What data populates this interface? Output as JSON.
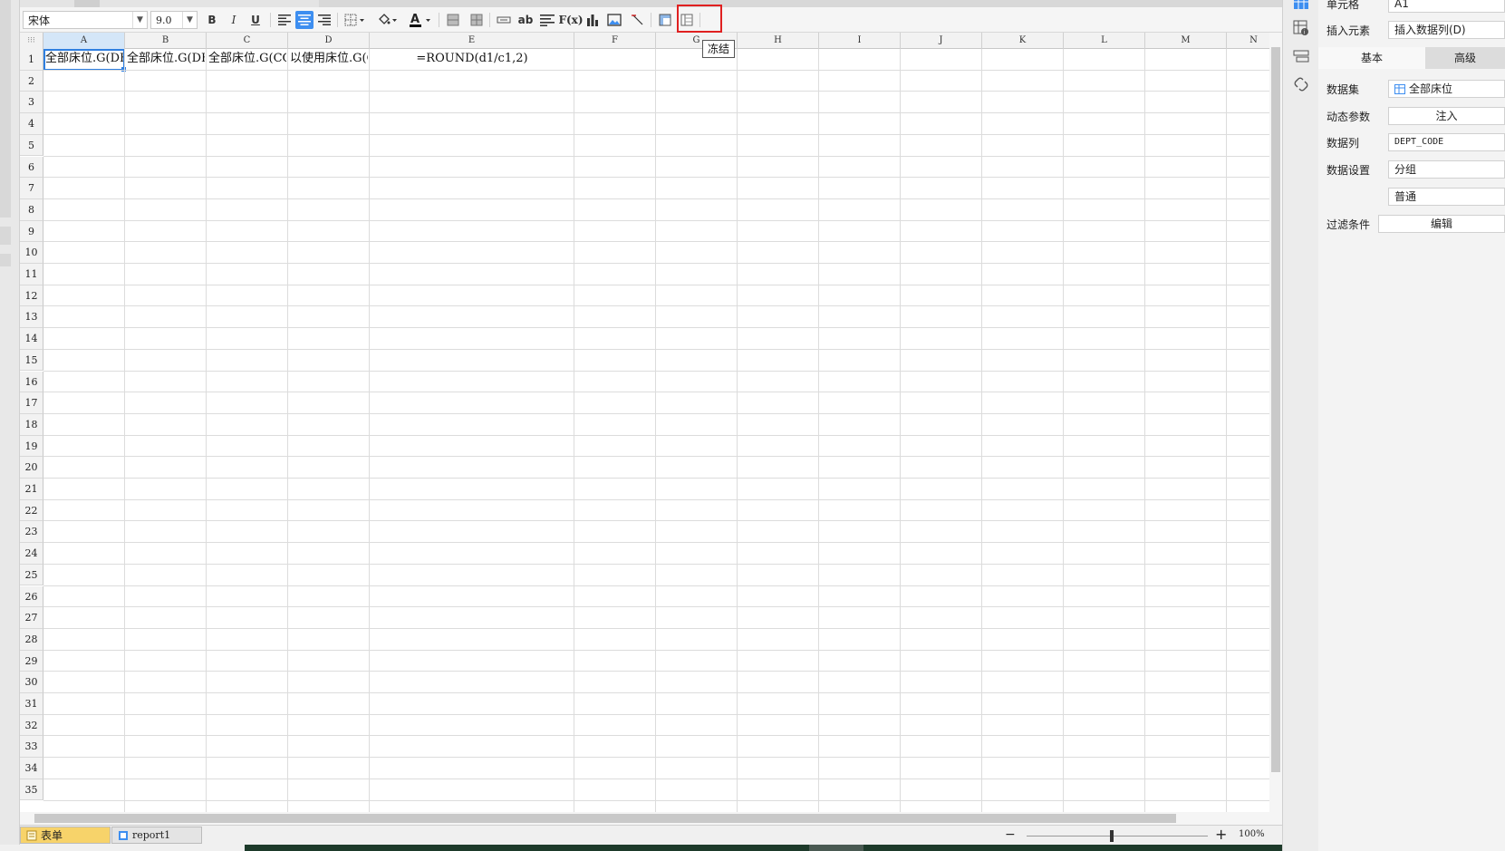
{
  "toolbar": {
    "font_name": "宋体",
    "font_size": "9.0",
    "bold": "B",
    "italic": "I",
    "underline": "U",
    "text_tool": "ab",
    "formula_tool": "F(x)",
    "tooltip": "冻结"
  },
  "columns": [
    "A",
    "B",
    "C",
    "D",
    "E",
    "F",
    "G",
    "H",
    "I",
    "J",
    "K",
    "L",
    "M",
    "N"
  ],
  "rows": [
    "1",
    "2",
    "3",
    "4",
    "5",
    "6",
    "7",
    "8",
    "9",
    "10",
    "11",
    "12",
    "13",
    "14",
    "15",
    "16",
    "17",
    "18",
    "19",
    "20",
    "21",
    "22",
    "23",
    "24",
    "25",
    "26",
    "27",
    "28",
    "29",
    "30",
    "31",
    "32",
    "33",
    "34",
    "35"
  ],
  "cells": {
    "a1": "全部床位.G(DEPT_CODE)",
    "b1": "全部床位.G(DEPT_NAME)",
    "c1": "全部床位.G(COUNT(*))",
    "d1": "以使用床位.G(COUNT(*))",
    "e1": "=ROUND(d1/c1,2)"
  },
  "sheets": {
    "form_tab": "表单",
    "report_tab": "report1"
  },
  "zoom": {
    "minus": "−",
    "plus": "+",
    "percent": "100%"
  },
  "panel": {
    "cell_label": "单元格",
    "cell_value": "A1",
    "insert_label": "插入元素",
    "insert_value": "插入数据列(D)",
    "tab_basic": "基本",
    "tab_advanced": "高级",
    "dataset_label": "数据集",
    "dataset_value": "全部床位",
    "dynamic_label": "动态参数",
    "dynamic_value": "注入",
    "datacol_label": "数据列",
    "datacol_value": "DEPT_CODE",
    "datasetting_label": "数据设置",
    "datasetting_value": "分组",
    "datasetting_value2": "普通",
    "filter_label": "过滤条件",
    "filter_value": "编辑"
  },
  "colors": {
    "accent": "#3d8ef0",
    "highlight_box": "#e02020",
    "form_tab": "#f7d36a"
  }
}
